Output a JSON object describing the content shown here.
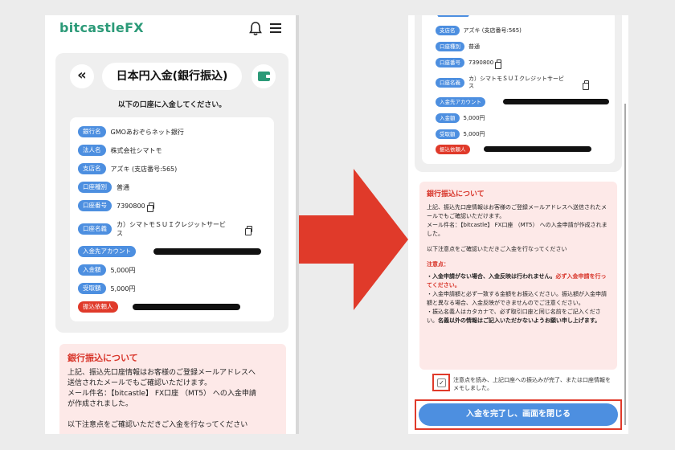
{
  "left": {
    "app_logo_main": "bitcastle",
    "app_logo_fx": "FX",
    "page_title": "日本円入金(銀行振込)",
    "back_icon": "«",
    "instruction": "以下の口座に入金してください。",
    "rows": [
      {
        "label": "銀行名",
        "value": "GMOあおぞらネット銀行"
      },
      {
        "label": "法人名",
        "value": "株式会社シマトモ"
      },
      {
        "label": "支店名",
        "value": "アズキ (支店番号:565)"
      },
      {
        "label": "口座種別",
        "value": "普通"
      },
      {
        "label": "口座番号",
        "value": "7390800"
      },
      {
        "label": "口座名義",
        "value_line1": "カ）シマトモＳＵＩクレジットサービ",
        "value_line2": "ス"
      },
      {
        "label": "入金先アカウント",
        "value": ""
      },
      {
        "label": "入金額",
        "value": "5,000円"
      },
      {
        "label": "受取額",
        "value": "5,000円"
      },
      {
        "label": "振込依頼人",
        "value": ""
      }
    ],
    "notice": {
      "title": "銀行振込について",
      "line1": "上記、振込先口座情報はお客様のご登録メールアドレスへ",
      "line2": "送信されたメールでもご確認いただけます。",
      "line3": "メール件名：【bitcastle】 FX口座 （MT5） への入金申請",
      "line4": "が作成されました。",
      "line5": "以下注意点をご確認いただきご入金を行なってください"
    }
  },
  "right": {
    "rows": [
      {
        "label": "支店名",
        "value": "アズキ (支店番号:565)"
      },
      {
        "label": "口座種別",
        "value": "普通"
      },
      {
        "label": "口座番号",
        "value": "7390800"
      },
      {
        "label": "口座名義",
        "value_line1": "カ）シマトモＳＵＩクレジットサービ",
        "value_line2": "ス"
      },
      {
        "label": "入金先アカウント",
        "value": ""
      },
      {
        "label": "入金額",
        "value": "5,000円"
      },
      {
        "label": "受取額",
        "value": "5,000円"
      },
      {
        "label": "振込依頼人",
        "value": ""
      }
    ],
    "notice": {
      "title": "銀行振込について",
      "p1": "上記、振込先口座情報はお客様のご登録メールアドレスへ送信されたメールでもご確認いただけます。",
      "p2": "メール件名：【bitcastle】 FX口座 （MT5） への入金申請が作成されました。",
      "p3": "以下注意点をご確認いただきご入金を行なってください",
      "caution_label": "注意点：",
      "c1_black": "・入金申請がない場合、入金反映は行われません。",
      "c1_red": "必ず入金申請を行ってください。",
      "c2": "・入金申請額と必ず一致する金額をお振込ください。振込額が入金申請額と異なる場合、入金反映ができませんのでご注意ください。",
      "c3_normal": "・振込名義人はカタカナで、必ず取引口座と同じ名前をご記入ください。",
      "c3_bold": "名義以外の情報はご記入いただかないようお願い申し上げます。"
    },
    "confirm_text": "注意点を読み、上記口座への振込みが完了、または口座情報をメモしました。",
    "checkmark": "✓",
    "done_button": "入金を完了し、画面を閉じる"
  }
}
